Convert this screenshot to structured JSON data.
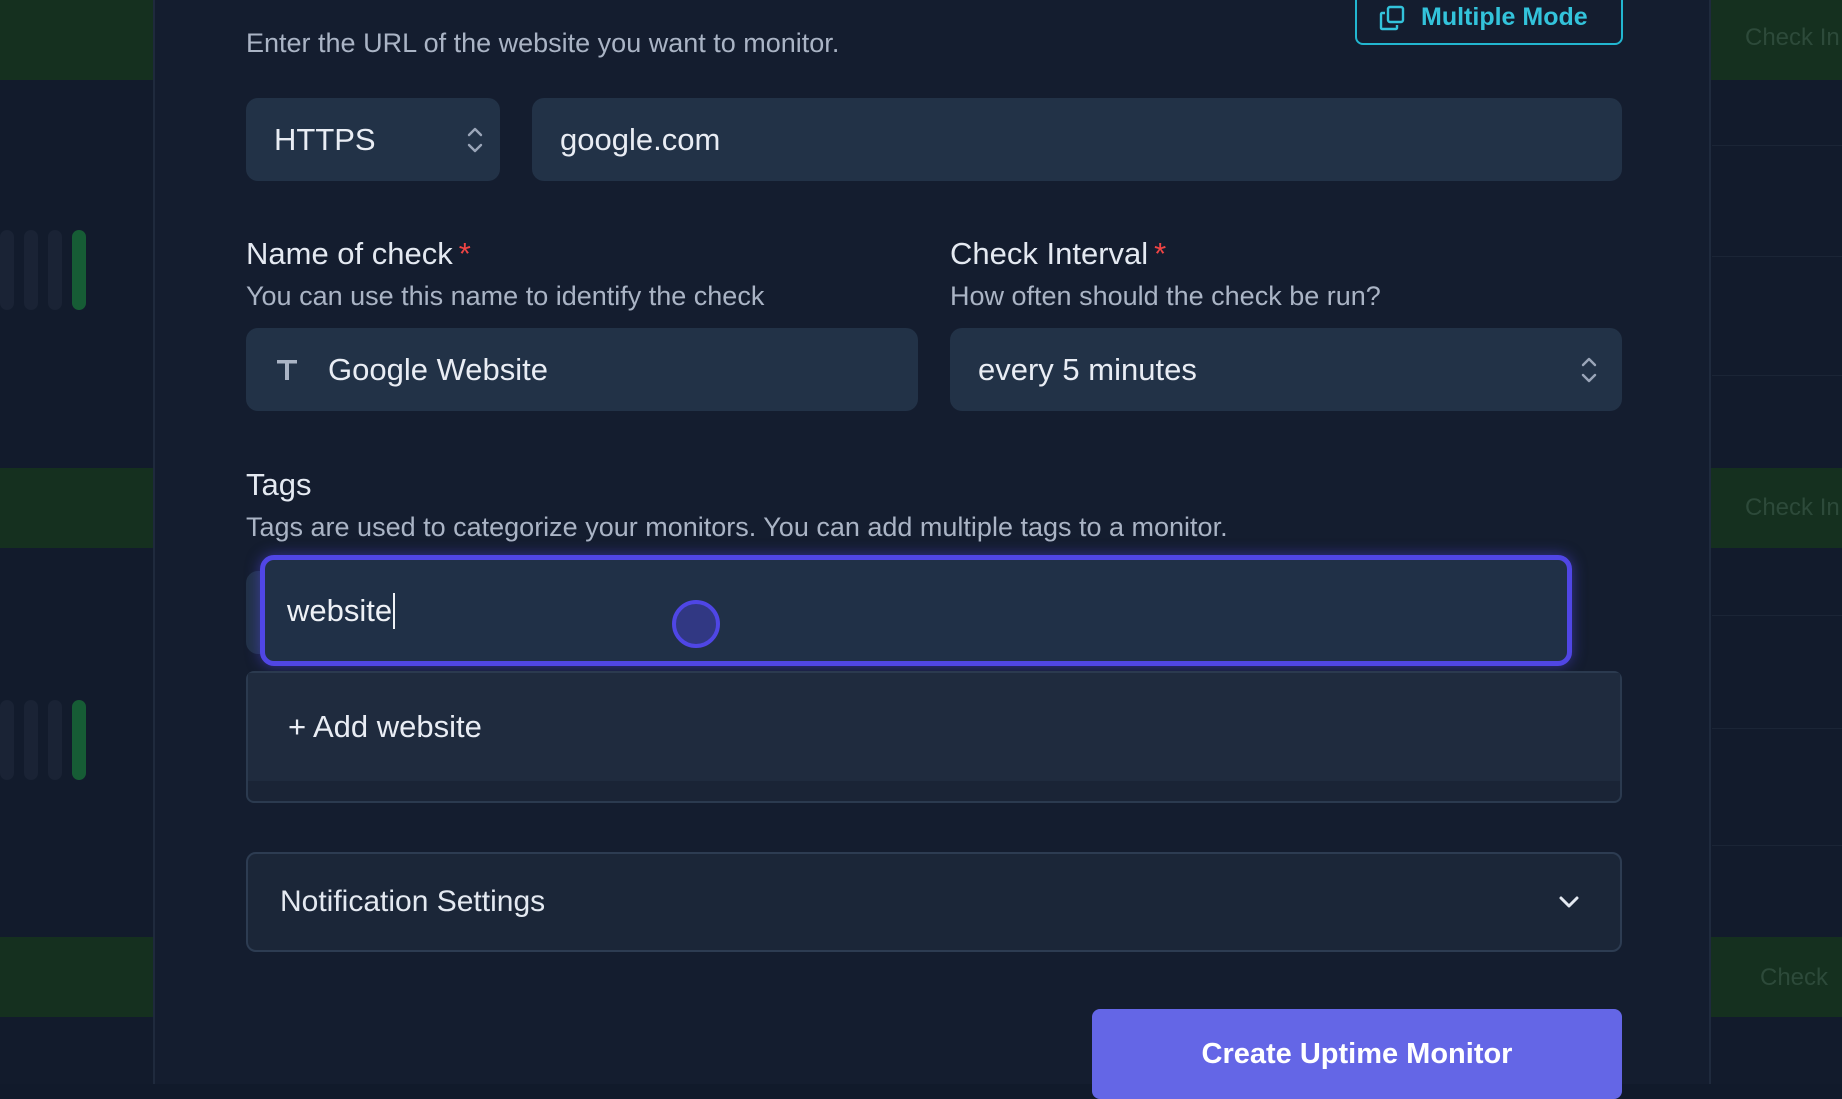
{
  "background": {
    "check_label": "Check In",
    "check_label_short": "Check"
  },
  "url_section": {
    "description": "Enter the URL of the website you want to monitor.",
    "multiple_mode_label": "Multiple Mode",
    "protocol": "HTTPS",
    "url_value": "google.com"
  },
  "name_field": {
    "label": "Name of check",
    "required_mark": "*",
    "description": "You can use this name to identify the check",
    "value": "Google Website"
  },
  "interval_field": {
    "label": "Check Interval",
    "required_mark": "*",
    "description": "How often should the check be run?",
    "value": "every 5 minutes"
  },
  "tags": {
    "label": "Tags",
    "description": "Tags are used to categorize your monitors. You can add multiple tags to a monitor.",
    "input_value": "website",
    "dropdown_option": "+ Add website"
  },
  "notification_settings": {
    "label": "Notification Settings"
  },
  "submit": {
    "label": "Create Uptime Monitor"
  },
  "colors": {
    "accent": "#5046e5",
    "button": "#6466e6",
    "multiple_mode": "#22b6d0",
    "required": "#ef4444"
  }
}
